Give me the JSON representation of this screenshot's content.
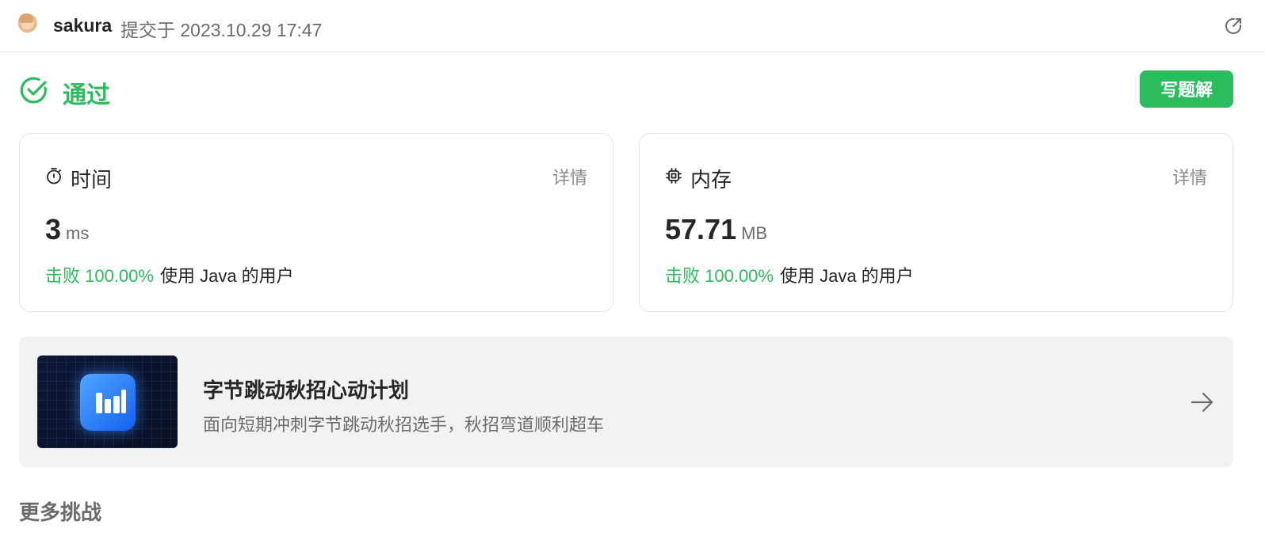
{
  "header": {
    "username": "sakura",
    "submitted_text": "提交于 2023.10.29 17:47",
    "avatar_icon": "avatar-image",
    "share_icon": "share-icon"
  },
  "status": {
    "text": "通过",
    "icon": "check-circle-icon",
    "color": "#2cbb5d"
  },
  "actions": {
    "write_solution_label": "写题解"
  },
  "runtime_card": {
    "icon": "stopwatch-icon",
    "title": "时间",
    "detail_label": "详情",
    "value": "3",
    "unit": "ms",
    "beat_text": "击败 100.00%",
    "beat_rest": "使用 Java 的用户"
  },
  "memory_card": {
    "icon": "chip-icon",
    "title": "内存",
    "detail_label": "详情",
    "value": "57.71",
    "unit": "MB",
    "beat_text": "击败 100.00%",
    "beat_rest": "使用 Java 的用户"
  },
  "promo": {
    "title": "字节跳动秋招心动计划",
    "subtitle": "面向短期冲刺字节跳动秋招选手，秋招弯道顺利超车",
    "arrow_icon": "arrow-right-icon"
  },
  "more_section": {
    "title": "更多挑战"
  }
}
